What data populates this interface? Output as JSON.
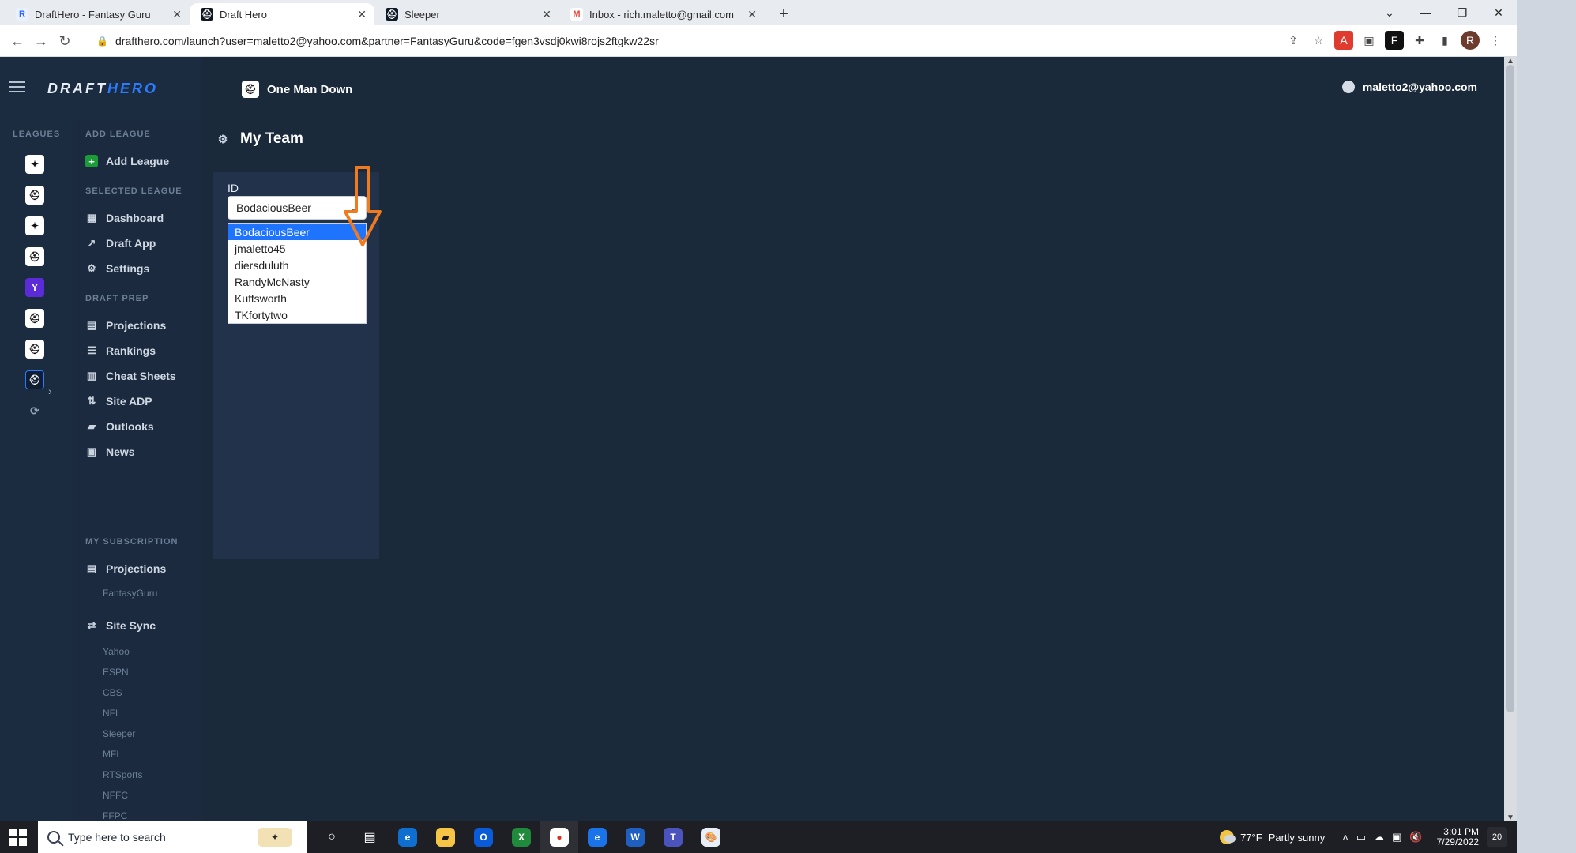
{
  "browser": {
    "tabs": [
      {
        "title": "DraftHero - Fantasy Guru",
        "icon": "drafthero-icon",
        "active": false
      },
      {
        "title": "Draft Hero",
        "icon": "drafthero-icon",
        "active": true
      },
      {
        "title": "Sleeper",
        "icon": "sleeper-icon",
        "active": false
      },
      {
        "title": "Inbox - rich.maletto@gmail.com",
        "icon": "gmail-icon",
        "active": false
      }
    ],
    "url": "drafthero.com/launch?user=maletto2@yahoo.com&partner=FantasyGuru&code=fgen3vsdj0kwi8rojs2ftgkw22sr"
  },
  "app": {
    "brand": {
      "part1": "DRAFT",
      "part2": "HERO"
    },
    "league_name": "One Man Down",
    "user_email": "maletto2@yahoo.com",
    "rail": {
      "section_label": "LEAGUES"
    },
    "sidebar": {
      "add_league_section": "ADD LEAGUE",
      "add_league_label": "Add League",
      "selected_league_section": "SELECTED LEAGUE",
      "dashboard": "Dashboard",
      "draft_app": "Draft App",
      "settings": "Settings",
      "draft_prep_section": "DRAFT PREP",
      "projections": "Projections",
      "rankings": "Rankings",
      "cheat_sheets": "Cheat Sheets",
      "site_adp": "Site ADP",
      "outlooks": "Outlooks",
      "news": "News",
      "my_subscription_section": "MY SUBSCRIPTION",
      "subscription_projections": "Projections",
      "subscription_provider": "FantasyGuru",
      "site_sync_label": "Site Sync",
      "site_sync_items": [
        "Yahoo",
        "ESPN",
        "CBS",
        "NFL",
        "Sleeper",
        "MFL",
        "RTSports",
        "NFFC",
        "FFPC"
      ]
    },
    "my_team": {
      "title": "My Team",
      "id_label": "ID",
      "selected": "BodaciousBeer",
      "options": [
        "BodaciousBeer",
        "jmaletto45",
        "diersduluth",
        "RandyMcNasty",
        "Kuffsworth",
        "TKfortytwo"
      ]
    }
  },
  "taskbar": {
    "search_placeholder": "Type here to search",
    "weather_temp": "77°F",
    "weather_desc": "Partly sunny",
    "time": "3:01 PM",
    "date": "7/29/2022",
    "notifications": "20"
  }
}
